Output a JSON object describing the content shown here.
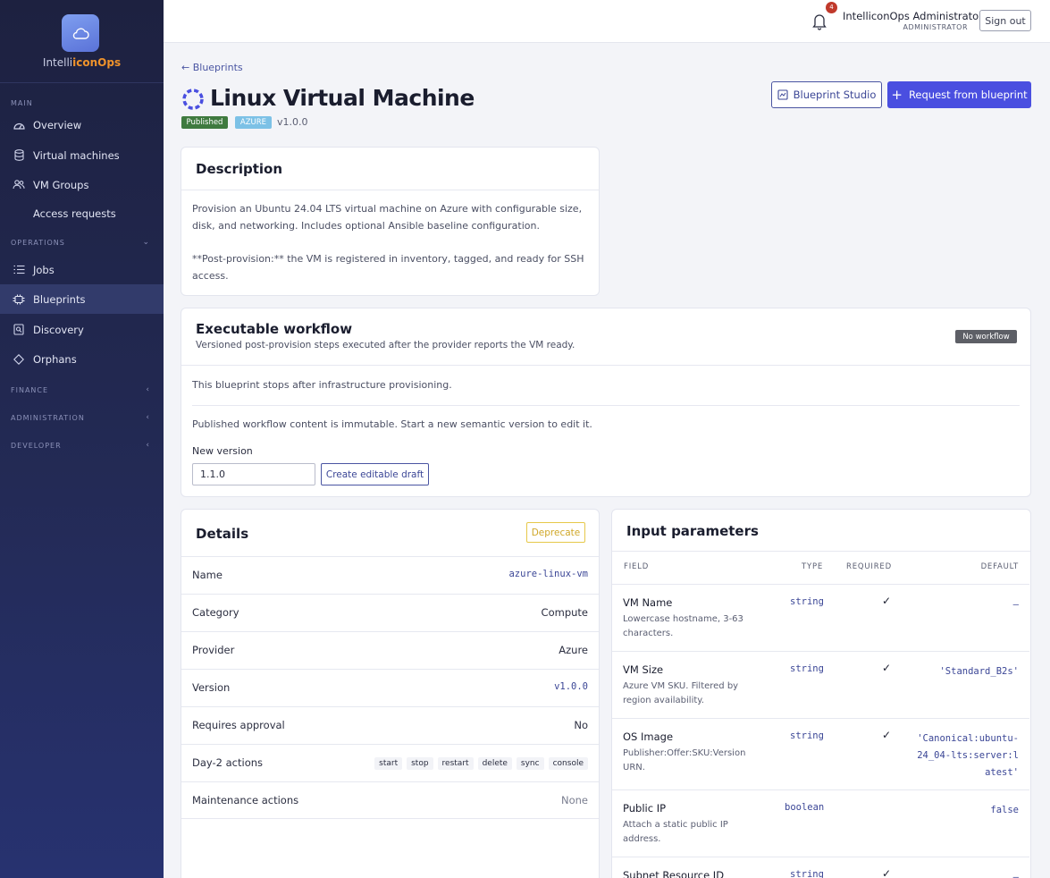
{
  "sidebar": {
    "brand_a": "Intelli",
    "brand_b": "iconOps",
    "sections": {
      "main": "MAIN",
      "operations": "OPERATIONS",
      "finance": "FINANCE",
      "administration": "ADMINISTRATION",
      "developer": "DEVELOPER"
    },
    "items": {
      "overview": "Overview",
      "vms": "Virtual machines",
      "vm_groups": "VM Groups",
      "access": "Access requests",
      "jobs": "Jobs",
      "blueprints": "Blueprints",
      "discovery": "Discovery",
      "orphans": "Orphans"
    }
  },
  "topbar": {
    "notif_count": "4",
    "user_name": "IntelliconOps Administrator",
    "user_role": "ADMINISTRATOR",
    "signout": "Sign out"
  },
  "header": {
    "back": "← Blueprints",
    "title": "Linux Virtual Machine",
    "status": "Published",
    "provider": "AZURE",
    "version": "v1.0.0",
    "studio_btn": "Blueprint Studio",
    "request_btn": "Request from blueprint"
  },
  "description": {
    "title": "Description",
    "para1": "Provision an Ubuntu 24.04 LTS virtual machine on Azure with configurable size, disk, and networking. Includes optional Ansible baseline configuration.",
    "para2": "**Post-provision:** the VM is registered in inventory, tagged, and ready for SSH access."
  },
  "workflow": {
    "title": "Executable workflow",
    "subtitle": "Versioned post-provision steps executed after the provider reports the VM ready.",
    "badge": "No workflow",
    "stops": "This blueprint stops after infrastructure provisioning.",
    "immutable": "Published workflow content is immutable. Start a new semantic version to edit it.",
    "new_version_label": "New version",
    "new_version_value": "1.1.0",
    "draft_btn": "Create editable draft"
  },
  "details": {
    "title": "Details",
    "deprecate": "Deprecate",
    "rows": [
      {
        "k": "Name",
        "v": "azure-linux-vm"
      },
      {
        "k": "Category",
        "v": "Compute"
      },
      {
        "k": "Provider",
        "v": "Azure"
      },
      {
        "k": "Version",
        "v": "v1.0.0"
      },
      {
        "k": "Requires approval",
        "v": "No"
      },
      {
        "k": "Day-2 actions",
        "v": ""
      },
      {
        "k": "Maintenance actions",
        "v": "None"
      }
    ],
    "day2": [
      "start",
      "stop",
      "restart",
      "delete",
      "sync",
      "console"
    ]
  },
  "params": {
    "title": "Input parameters",
    "headers": {
      "field": "FIELD",
      "type": "TYPE",
      "required": "REQUIRED",
      "default": "DEFAULT"
    },
    "rows": [
      {
        "name": "VM Name",
        "desc": "Lowercase hostname, 3-63 characters.",
        "type": "string",
        "req": "✓",
        "def": "—"
      },
      {
        "name": "VM Size",
        "desc": "Azure VM SKU. Filtered by region availability.",
        "type": "string",
        "req": "✓",
        "def": "'Standard_B2s'"
      },
      {
        "name": "OS Image",
        "desc": "Publisher:Offer:SKU:Version URN.",
        "type": "string",
        "req": "✓",
        "def": "'Canonical:ubuntu-24_04-lts:server:latest'"
      },
      {
        "name": "Public IP",
        "desc": "Attach a static public IP address.",
        "type": "boolean",
        "req": "",
        "def": "false"
      },
      {
        "name": "Subnet Resource ID",
        "desc": "",
        "type": "string",
        "req": "✓",
        "def": "—"
      }
    ]
  }
}
